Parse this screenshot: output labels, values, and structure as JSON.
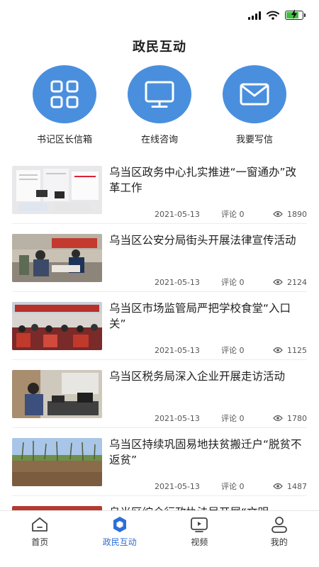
{
  "header": {
    "title": "政民互动"
  },
  "quick_actions": [
    {
      "label": "书记区长信箱",
      "icon": "grid-icon"
    },
    {
      "label": "在线咨询",
      "icon": "monitor-icon"
    },
    {
      "label": "我要写信",
      "icon": "mail-icon"
    }
  ],
  "news": [
    {
      "title": "乌当区政务中心扎实推进“一窗通办”改革工作",
      "date": "2021-05-13",
      "comment": "评论 0",
      "views": "1890"
    },
    {
      "title": "乌当区公安分局街头开展法律宣传活动",
      "date": "2021-05-13",
      "comment": "评论 0",
      "views": "2124"
    },
    {
      "title": "乌当区市场监管局严把学校食堂“入口关”",
      "date": "2021-05-13",
      "comment": "评论 0",
      "views": "1125"
    },
    {
      "title": "乌当区税务局深入企业开展走访活动",
      "date": "2021-05-13",
      "comment": "评论 0",
      "views": "1780"
    },
    {
      "title": "乌当区持续巩固易地扶贫搬迁户“脱贫不返贫”",
      "date": "2021-05-13",
      "comment": "评论 0",
      "views": "1487"
    },
    {
      "title": "乌当区综合行政执法局开展“文明",
      "date": "",
      "comment": "",
      "views": ""
    }
  ],
  "tabs": [
    {
      "label": "首页",
      "icon": "home-icon",
      "active": false
    },
    {
      "label": "政民互动",
      "icon": "interaction-icon",
      "active": true
    },
    {
      "label": "视频",
      "icon": "video-icon",
      "active": false
    },
    {
      "label": "我的",
      "icon": "user-icon",
      "active": false
    }
  ],
  "colors": {
    "accent": "#4a8fde",
    "active_tab": "#2d6fd6",
    "battery": "#3ec23e"
  }
}
